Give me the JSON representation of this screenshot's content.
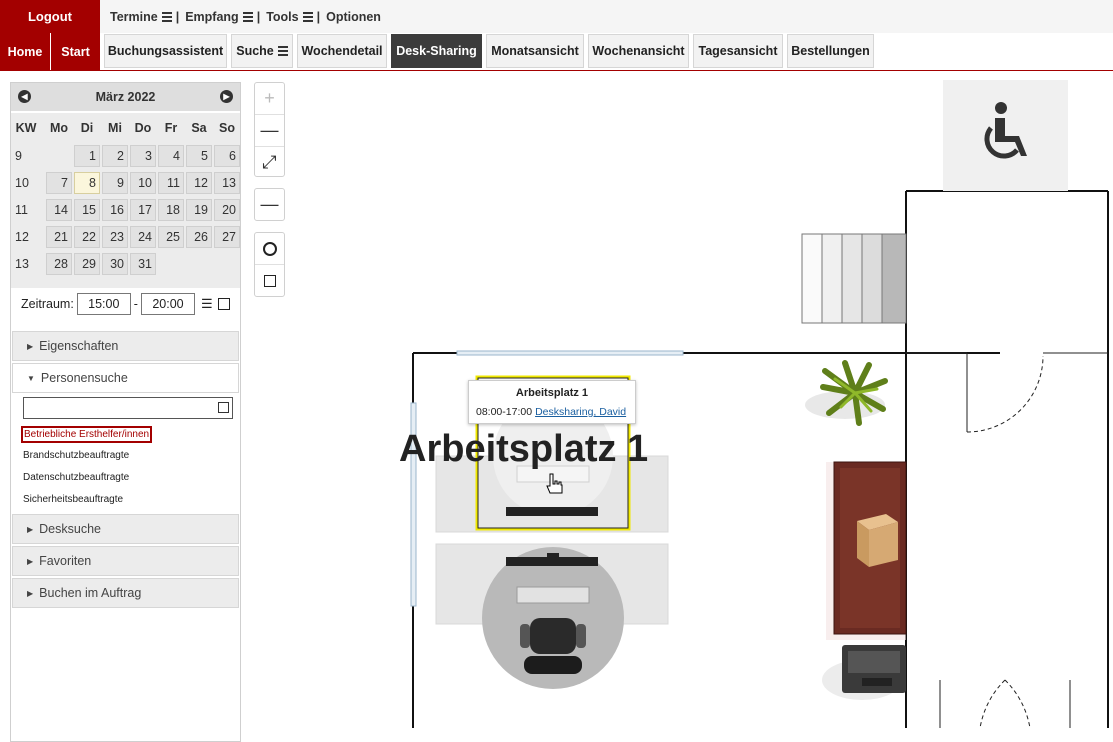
{
  "topbar": {
    "logout": "Logout",
    "menu": [
      "Termine",
      "Empfang",
      "Tools",
      "Optionen"
    ],
    "separator": "|"
  },
  "nav": {
    "home": "Home",
    "start": "Start",
    "tabs": [
      "Buchungsassistent",
      "Suche",
      "Wochendetail",
      "Desk-Sharing",
      "Monatsansicht",
      "Wochenansicht",
      "Tagesansicht",
      "Bestellungen"
    ],
    "active_tab": "Desk-Sharing"
  },
  "calendar": {
    "month": "März 2022",
    "headers": [
      "KW",
      "Mo",
      "Di",
      "Mi",
      "Do",
      "Fr",
      "Sa",
      "So"
    ],
    "weeks": [
      {
        "kw": "9",
        "days": [
          "",
          "1",
          "2",
          "3",
          "4",
          "5",
          "6"
        ]
      },
      {
        "kw": "10",
        "days": [
          "7",
          "8",
          "9",
          "10",
          "11",
          "12",
          "13"
        ]
      },
      {
        "kw": "11",
        "days": [
          "14",
          "15",
          "16",
          "17",
          "18",
          "19",
          "20"
        ]
      },
      {
        "kw": "12",
        "days": [
          "21",
          "22",
          "23",
          "24",
          "25",
          "26",
          "27"
        ]
      },
      {
        "kw": "13",
        "days": [
          "28",
          "29",
          "30",
          "31",
          "",
          "",
          ""
        ]
      }
    ],
    "today": "8"
  },
  "zeitraum": {
    "label": "Zeitraum:",
    "from": "15:00",
    "dash": "-",
    "to": "20:00"
  },
  "accordion": {
    "eigenschaften": "Eigenschaften",
    "personensuche": "Personensuche",
    "desksuche": "Desksuche",
    "favoriten": "Favoriten",
    "buchen": "Buchen im Auftrag"
  },
  "person_links": [
    "Betriebliche Ersthelfer/innen",
    "Brandschutzbeauftragte",
    "Datenschutzbeauftragte",
    "Sicherheitsbeauftragte"
  ],
  "map": {
    "desk_label": "Arbeitsplatz 1",
    "popup": {
      "title": "Arbeitsplatz 1",
      "time": "08:00-17:00",
      "person": "Desksharing, David"
    },
    "accent": "#a30000",
    "highlight": "#f0e800"
  }
}
